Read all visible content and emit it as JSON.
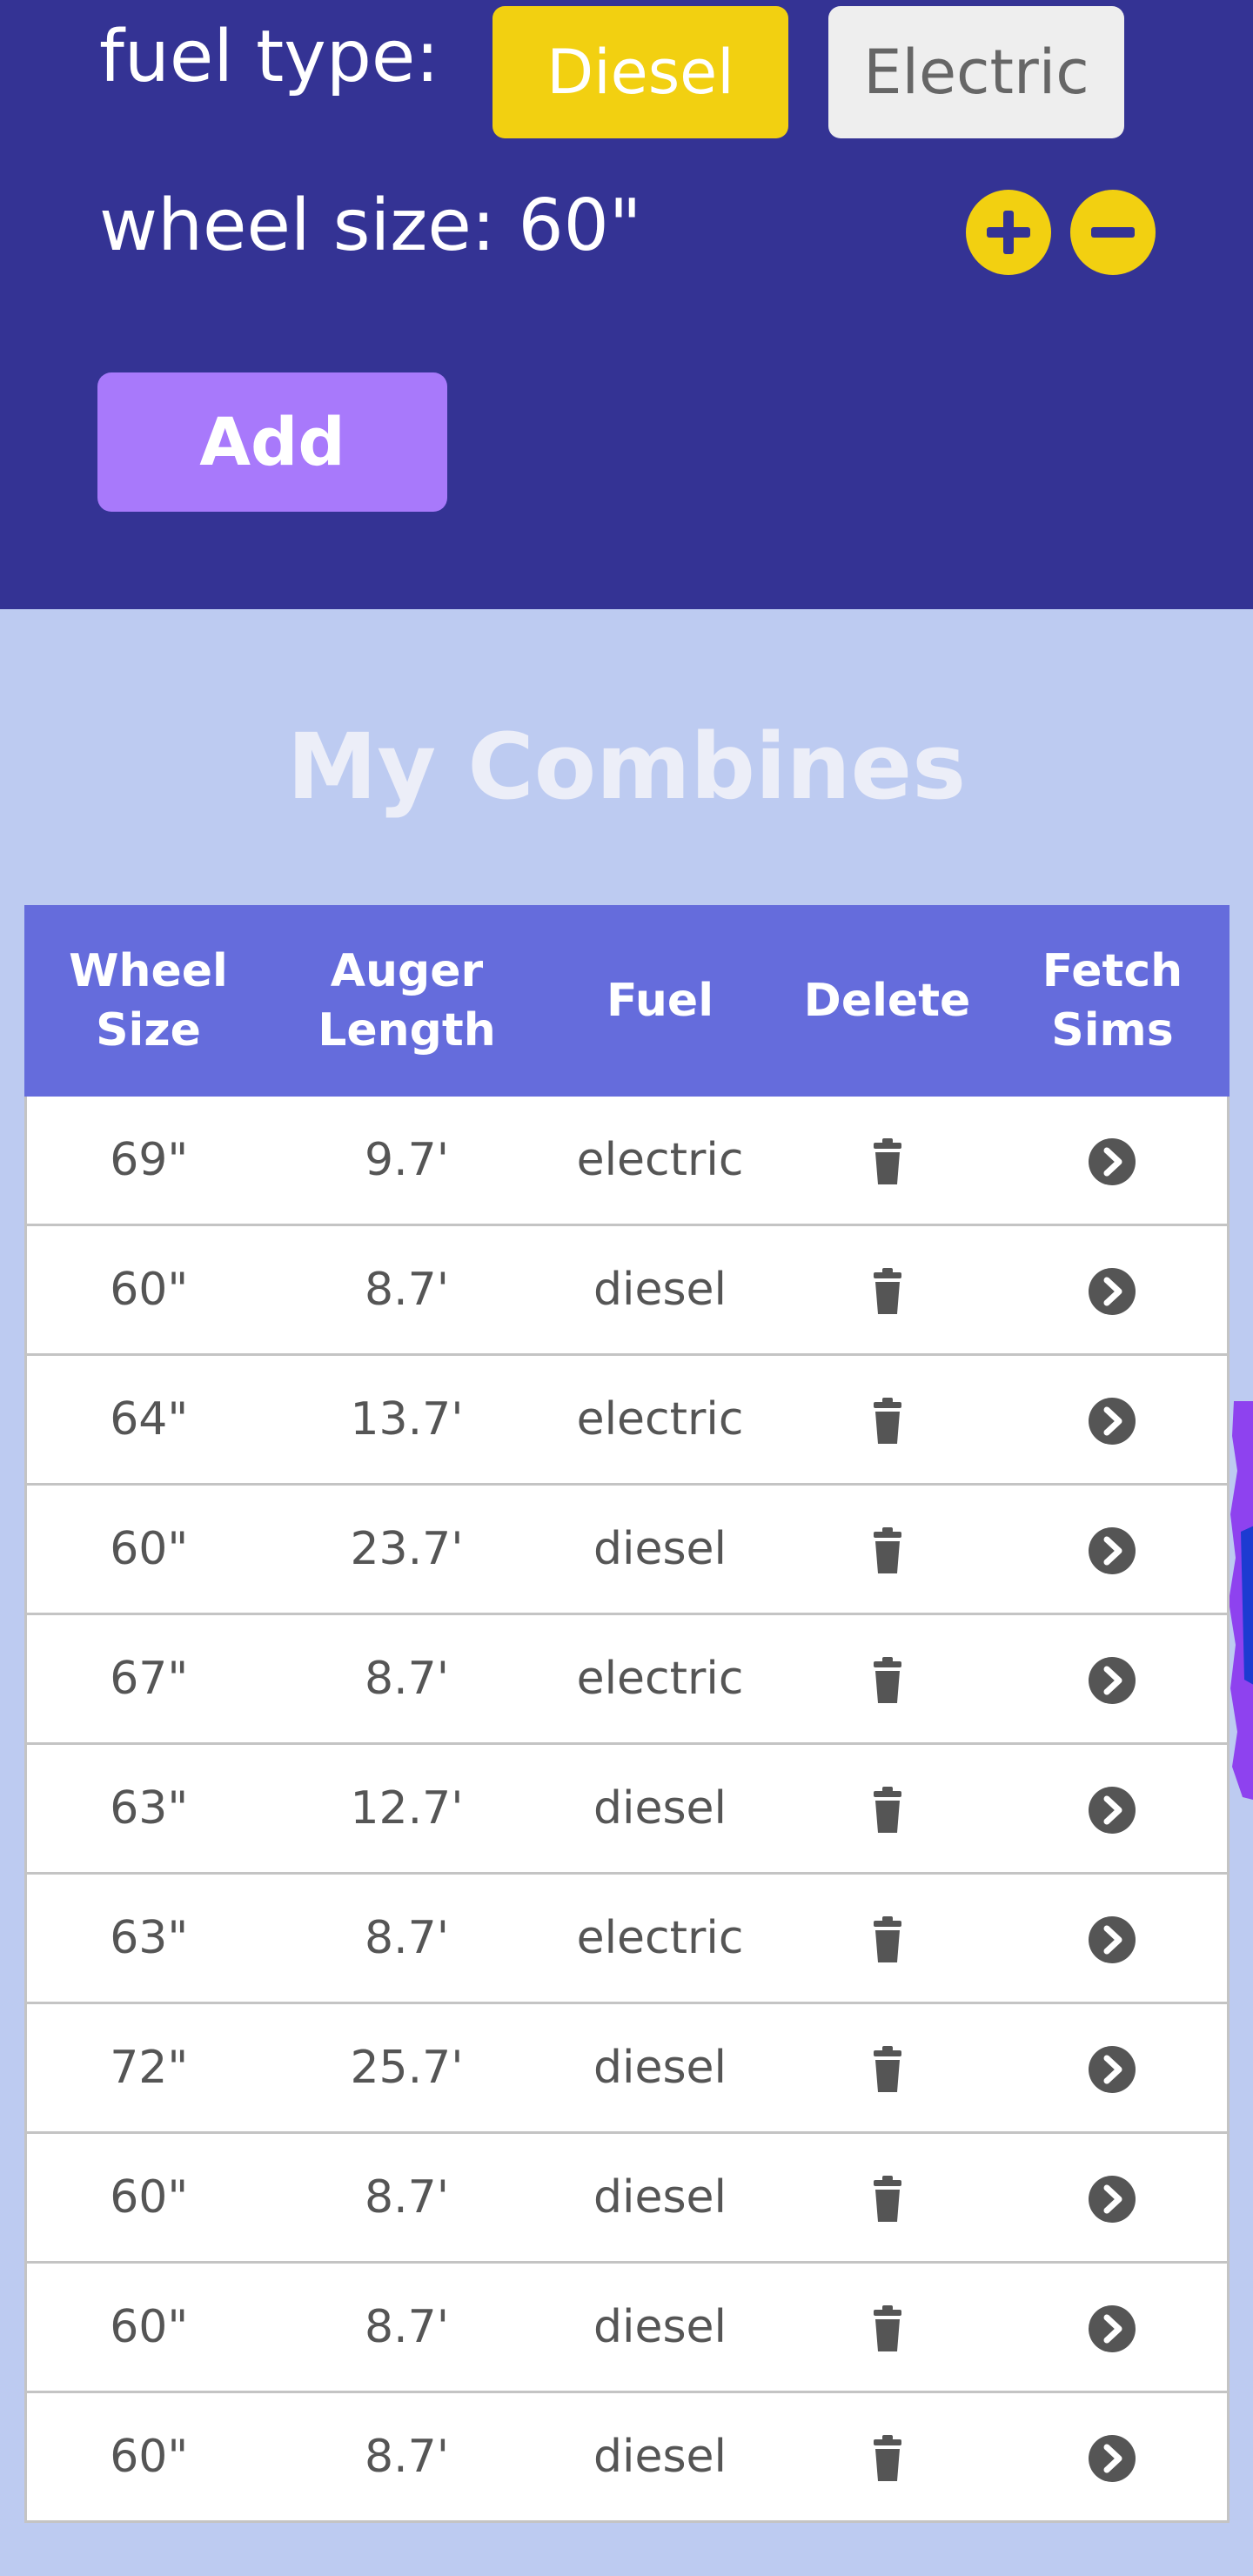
{
  "form": {
    "fuel_label": "fuel type:",
    "fuel_options": [
      "Diesel",
      "Electric"
    ],
    "selected_fuel": "Diesel",
    "wheel_label": "wheel size: 60\"",
    "increase_icon": "plus-circle-icon",
    "decrease_icon": "minus-circle-icon",
    "add_label": "Add"
  },
  "section": {
    "title": "My Combines"
  },
  "table": {
    "headers": [
      [
        "Wheel",
        "Size"
      ],
      [
        "Auger",
        "Length"
      ],
      [
        "Fuel"
      ],
      [
        "Delete"
      ],
      [
        "Fetch",
        "Sims"
      ]
    ],
    "delete_icon": "trash-icon",
    "fetch_icon": "chevron-circle-right-icon",
    "rows": [
      {
        "wheel": "69\"",
        "auger": "9.7'",
        "fuel": "electric"
      },
      {
        "wheel": "60\"",
        "auger": "8.7'",
        "fuel": "diesel"
      },
      {
        "wheel": "64\"",
        "auger": "13.7'",
        "fuel": "electric"
      },
      {
        "wheel": "60\"",
        "auger": "23.7'",
        "fuel": "diesel"
      },
      {
        "wheel": "67\"",
        "auger": "8.7'",
        "fuel": "electric"
      },
      {
        "wheel": "63\"",
        "auger": "12.7'",
        "fuel": "diesel"
      },
      {
        "wheel": "63\"",
        "auger": "8.7'",
        "fuel": "electric"
      },
      {
        "wheel": "72\"",
        "auger": "25.7'",
        "fuel": "diesel"
      },
      {
        "wheel": "60\"",
        "auger": "8.7'",
        "fuel": "diesel"
      },
      {
        "wheel": "60\"",
        "auger": "8.7'",
        "fuel": "diesel"
      },
      {
        "wheel": "60\"",
        "auger": "8.7'",
        "fuel": "diesel"
      }
    ]
  },
  "colors": {
    "header_bg": "#343394",
    "page_bg": "#bdcbf1",
    "accent_yellow": "#f2d011",
    "add_button": "#a879fb",
    "table_header": "#656cdc",
    "cell_text": "#555555"
  }
}
